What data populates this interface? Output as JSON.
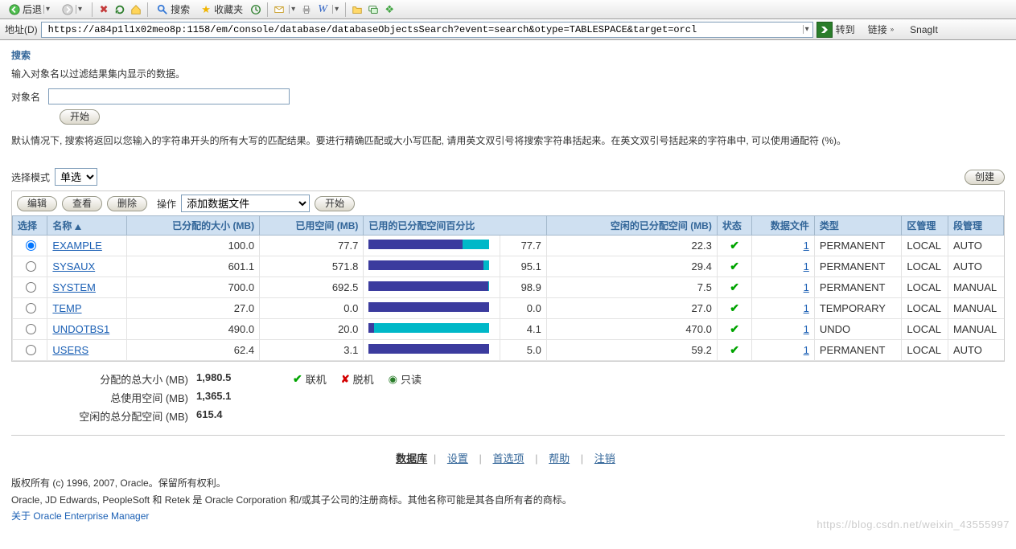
{
  "toolbar": {
    "back_label": "后退",
    "search_label": "搜索",
    "fav_label": "收藏夹"
  },
  "address_bar": {
    "label": "地址(D)",
    "url": "https://a84p1l1x02meo8p:1158/em/console/database/databaseObjectsSearch?event=search&otype=TABLESPACE&target=orcl",
    "go_label": "转到",
    "links_label": "链接",
    "snagit_label": "SnagIt"
  },
  "search": {
    "title": "搜索",
    "hint": "输入对象名以过滤结果集内显示的数据。",
    "object_name_label": "对象名",
    "start_button": "开始",
    "note": "默认情况下, 搜索将返回以您输入的字符串开头的所有大写的匹配结果。要进行精确匹配或大小写匹配, 请用英文双引号将搜索字符串括起来。在英文双引号括起来的字符串中, 可以使用通配符 (%)。"
  },
  "grid": {
    "create_button": "创建",
    "mode_label": "选择模式",
    "mode_value": "单选",
    "edit_button": "编辑",
    "view_button": "查看",
    "delete_button": "删除",
    "action_label": "操作",
    "action_value": "添加数据文件",
    "action_start": "开始",
    "headers": {
      "select": "选择",
      "name": "名称",
      "allocated": "已分配的大小 (MB)",
      "used": "已用空间 (MB)",
      "pct_bar": "已用的已分配空间百分比",
      "pct_val": "",
      "free": "空闲的已分配空间 (MB)",
      "status": "状态",
      "datafiles": "数据文件",
      "type": "类型",
      "ext": "区管理",
      "seg": "段管理"
    },
    "rows": [
      {
        "selected": true,
        "name": "EXAMPLE",
        "allocated": "100.0",
        "used": "77.7",
        "pct": 77.7,
        "pct_txt": "77.7",
        "free": "22.3",
        "status": "ok",
        "datafiles": "1",
        "type": "PERMANENT",
        "ext": "LOCAL",
        "seg": "AUTO"
      },
      {
        "selected": false,
        "name": "SYSAUX",
        "allocated": "601.1",
        "used": "571.8",
        "pct": 95.1,
        "pct_txt": "95.1",
        "free": "29.4",
        "status": "ok",
        "datafiles": "1",
        "type": "PERMANENT",
        "ext": "LOCAL",
        "seg": "AUTO"
      },
      {
        "selected": false,
        "name": "SYSTEM",
        "allocated": "700.0",
        "used": "692.5",
        "pct": 98.9,
        "pct_txt": "98.9",
        "free": "7.5",
        "status": "ok",
        "datafiles": "1",
        "type": "PERMANENT",
        "ext": "LOCAL",
        "seg": "MANUAL"
      },
      {
        "selected": false,
        "name": "TEMP",
        "allocated": "27.0",
        "used": "0.0",
        "pct": 100.0,
        "pct_txt": "0.0",
        "free": "27.0",
        "status": "ok",
        "datafiles": "1",
        "type": "TEMPORARY",
        "ext": "LOCAL",
        "seg": "MANUAL"
      },
      {
        "selected": false,
        "name": "UNDOTBS1",
        "allocated": "490.0",
        "used": "20.0",
        "pct": 4.1,
        "pct_txt": "4.1",
        "free": "470.0",
        "status": "ok",
        "datafiles": "1",
        "type": "UNDO",
        "ext": "LOCAL",
        "seg": "MANUAL"
      },
      {
        "selected": false,
        "name": "USERS",
        "allocated": "62.4",
        "used": "3.1",
        "pct": 100.0,
        "pct_txt": "5.0",
        "free": "59.2",
        "status": "ok",
        "datafiles": "1",
        "type": "PERMANENT",
        "ext": "LOCAL",
        "seg": "AUTO"
      }
    ]
  },
  "summary": {
    "allocated_label": "分配的总大小 (MB)",
    "allocated_value": "1,980.5",
    "used_label": "总使用空间 (MB)",
    "used_value": "1,365.1",
    "free_label": "空闲的总分配空间 (MB)",
    "free_value": "615.4",
    "legend_online": "联机",
    "legend_offline": "脱机",
    "legend_readonly": "只读"
  },
  "footer": {
    "database": "数据库",
    "settings": "设置",
    "prefs": "首选项",
    "help": "帮助",
    "logout": "注销",
    "copy1": "版权所有 (c) 1996, 2007, Oracle。保留所有权利。",
    "copy2": "Oracle, JD Edwards, PeopleSoft 和 Retek 是 Oracle Corporation 和/或其子公司的注册商标。其他名称可能是其各自所有者的商标。",
    "about": "关于 Oracle Enterprise Manager"
  },
  "watermark": "https://blog.csdn.net/weixin_43555997"
}
